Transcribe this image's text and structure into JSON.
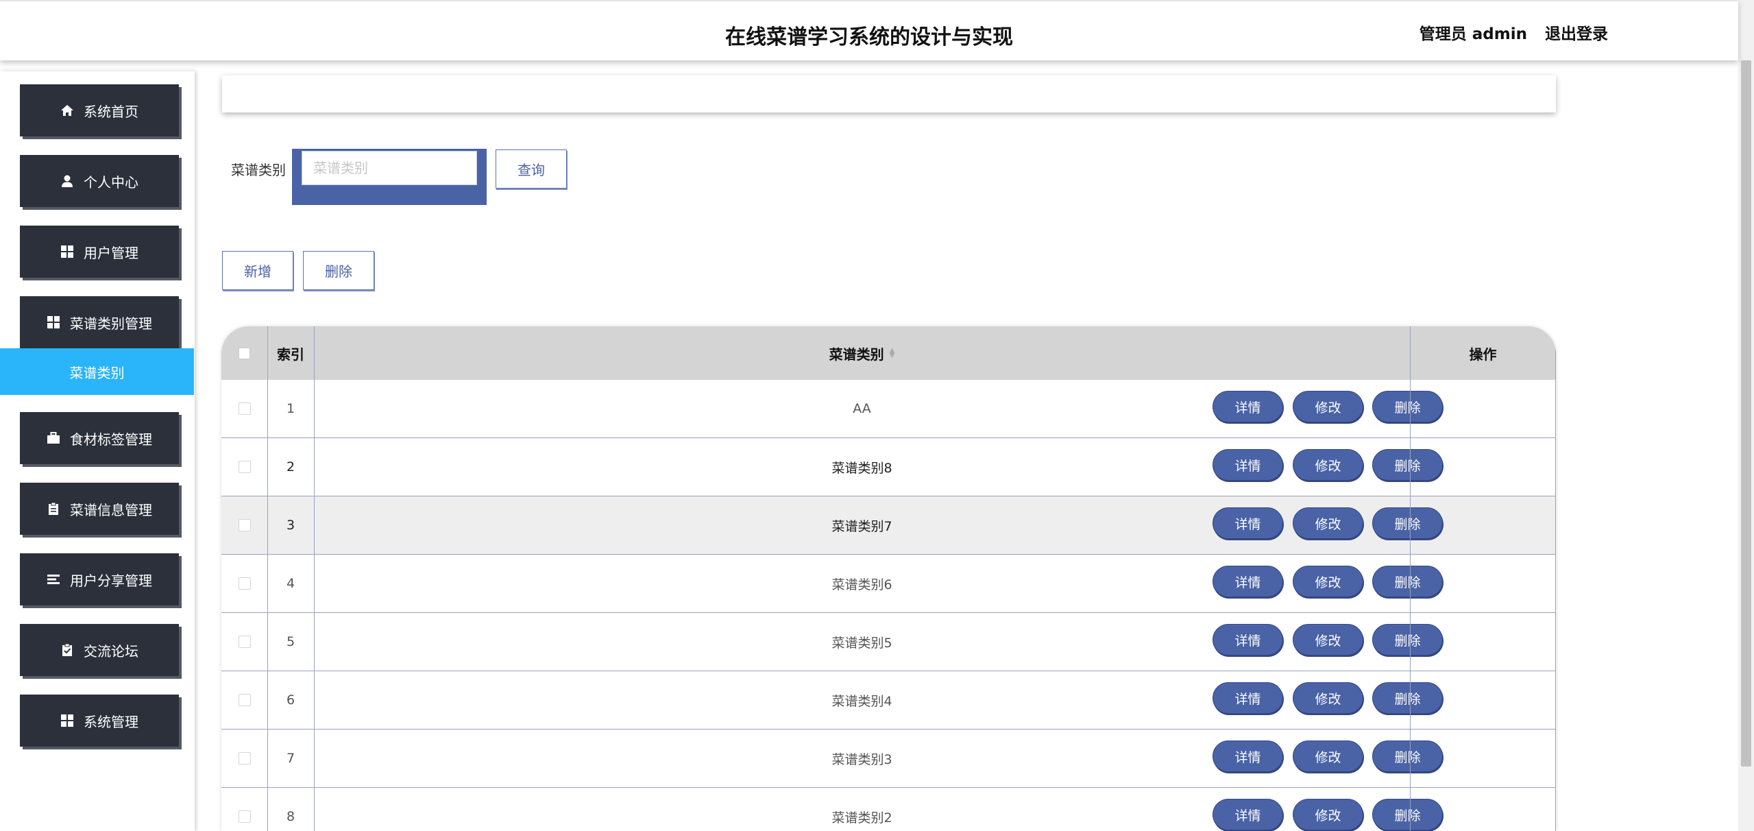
{
  "header": {
    "title": "在线菜谱学习系统的设计与实现",
    "user_label": "管理员 admin",
    "logout_label": "退出登录"
  },
  "sidebar": {
    "items": [
      {
        "label": "系统首页",
        "icon": "home-icon"
      },
      {
        "label": "个人中心",
        "icon": "user-icon"
      },
      {
        "label": "用户管理",
        "icon": "grid-icon"
      },
      {
        "label": "菜谱类别管理",
        "icon": "grid-icon"
      },
      {
        "label": "食材标签管理",
        "icon": "briefcase-icon"
      },
      {
        "label": "菜谱信息管理",
        "icon": "clipboard-icon"
      },
      {
        "label": "用户分享管理",
        "icon": "list-icon"
      },
      {
        "label": "交流论坛",
        "icon": "clipboard-check-icon"
      },
      {
        "label": "系统管理",
        "icon": "grid-icon"
      }
    ],
    "active_sub": "菜谱类别"
  },
  "search": {
    "label": "菜谱类别",
    "placeholder": "菜谱类别",
    "value": "",
    "query_button": "查询"
  },
  "toolbar": {
    "add_label": "新增",
    "delete_label": "删除"
  },
  "table": {
    "headers": {
      "index": "索引",
      "category": "菜谱类别",
      "actions": "操作"
    },
    "rows": [
      {
        "index": "1",
        "category": "AA"
      },
      {
        "index": "2",
        "category": "菜谱类别8"
      },
      {
        "index": "3",
        "category": "菜谱类别7"
      },
      {
        "index": "4",
        "category": "菜谱类别6"
      },
      {
        "index": "5",
        "category": "菜谱类别5"
      },
      {
        "index": "6",
        "category": "菜谱类别4"
      },
      {
        "index": "7",
        "category": "菜谱类别3"
      },
      {
        "index": "8",
        "category": "菜谱类别2"
      }
    ],
    "row_actions": {
      "detail": "详情",
      "edit": "修改",
      "delete": "删除"
    }
  },
  "colors": {
    "accent": "#4a63a6",
    "sidebar_bg": "#2b303b",
    "active_sub": "#2ab4fa",
    "table_header": "#d4d4d4"
  }
}
